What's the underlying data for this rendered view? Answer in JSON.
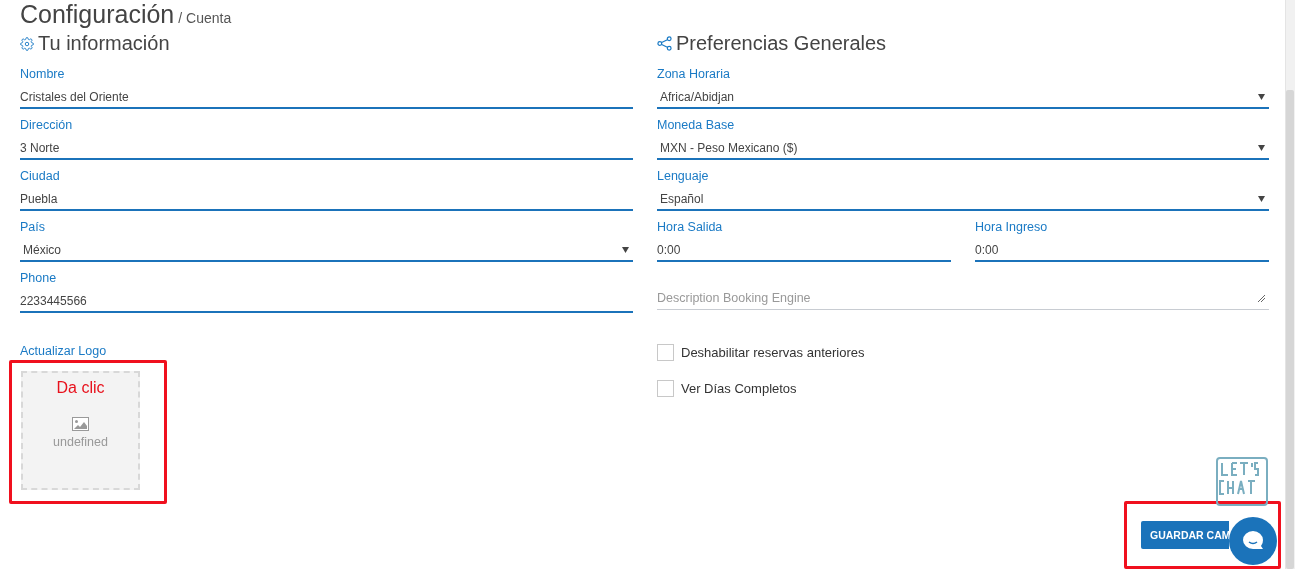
{
  "header": {
    "title": "Configuración",
    "breadcrumb": "/ Cuenta"
  },
  "left": {
    "heading": "Tu información",
    "fields": [
      {
        "kind": "text",
        "label": "Nombre",
        "value": "Cristales del Oriente"
      },
      {
        "kind": "text",
        "label": "Dirección",
        "value": "3 Norte"
      },
      {
        "kind": "text",
        "label": "Ciudad",
        "value": "Puebla"
      },
      {
        "kind": "select",
        "label": "País",
        "value": "México"
      },
      {
        "kind": "text",
        "label": "Phone",
        "value": "2233445566"
      }
    ],
    "logo": {
      "label": "Actualizar Logo",
      "annotation": "Da clic",
      "caption": "undefined"
    }
  },
  "right": {
    "heading": "Preferencias Generales",
    "fields": [
      {
        "kind": "select",
        "label": "Zona Horaria",
        "value": "Africa/Abidjan"
      },
      {
        "kind": "select",
        "label": "Moneda Base",
        "value": "MXN - Peso Mexicano ($)"
      },
      {
        "kind": "select",
        "label": "Lenguaje",
        "value": "Español"
      },
      {
        "kind": "pair",
        "fields": [
          {
            "kind": "text",
            "label": "Hora Salida",
            "value": "0:00"
          },
          {
            "kind": "text",
            "label": "Hora Ingreso",
            "value": "0:00"
          }
        ]
      },
      {
        "kind": "textarea",
        "placeholder": "Description Booking Engine"
      }
    ],
    "checkboxes": [
      {
        "label": "Deshabilitar reservas anteriores",
        "checked": false
      },
      {
        "label": "Ver Días Completos",
        "checked": false
      }
    ]
  },
  "save_button": "GUARDAR CAM"
}
